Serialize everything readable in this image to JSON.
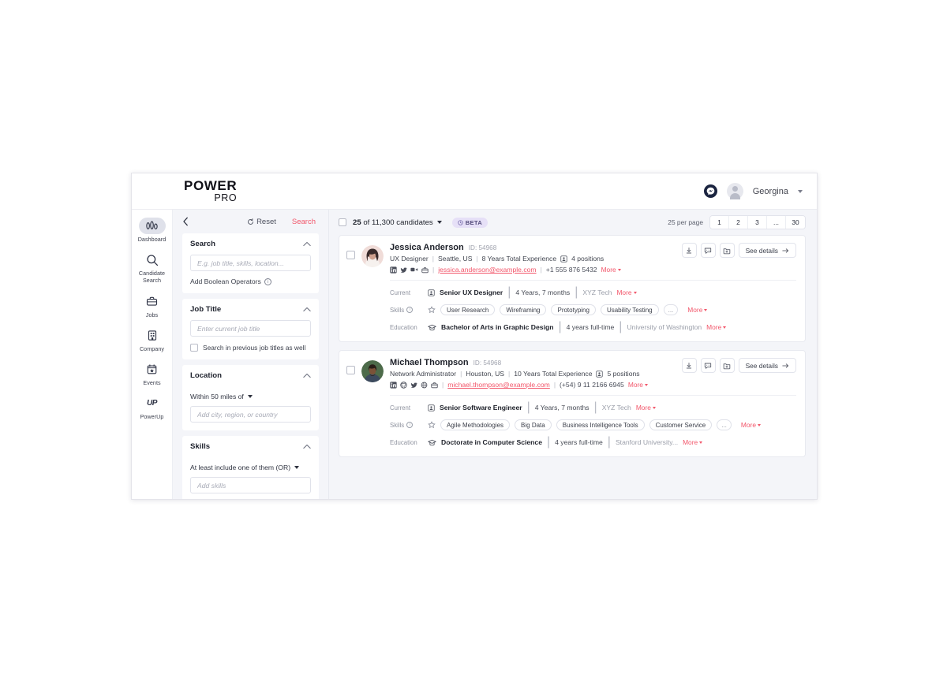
{
  "topbar": {
    "logo_line1": "POWER",
    "logo_line2": "PRO",
    "messenger_icon": "messenger-icon",
    "user_name": "Georgina"
  },
  "rail": {
    "items": [
      {
        "label": "Dashboard",
        "icon": "bar-chart-icon",
        "active": true
      },
      {
        "label": "Candidate Search",
        "icon": "magnifier-icon",
        "active": false
      },
      {
        "label": "Jobs",
        "icon": "briefcase-icon",
        "active": false
      },
      {
        "label": "Company",
        "icon": "building-icon",
        "active": false
      },
      {
        "label": "Events",
        "icon": "calendar-star-icon",
        "active": false
      },
      {
        "label": "PowerUp",
        "icon": "powerup-icon",
        "active": false
      }
    ]
  },
  "filters": {
    "back_icon": "chevron-left-icon",
    "reset_label": "Reset",
    "reset_icon": "refresh-icon",
    "search_label": "Search",
    "search_group": {
      "title": "Search",
      "input_placeholder": "E.g. job title, skills, location...",
      "boolean_label": "Add Boolean Operators",
      "boolean_info_icon": "info-icon"
    },
    "job_title_group": {
      "title": "Job Title",
      "input_placeholder": "Enter current job title",
      "checkbox_label": "Search in previous job titles as well"
    },
    "location_group": {
      "title": "Location",
      "radius_label": "Within 50 miles of",
      "input_placeholder": "Add city, region, or country"
    },
    "skills_group": {
      "title": "Skills",
      "operator_label": "At least include one of them (OR)",
      "input_placeholder": "Add skills"
    }
  },
  "results": {
    "toolbar": {
      "count_bold": "25",
      "count_rest": " of 11,300 candidates",
      "beta_label": "BETA",
      "beta_icon": "clock-icon",
      "per_page_label": "25 per page",
      "pages": [
        "1",
        "2",
        "3",
        "...",
        "30"
      ]
    },
    "actions": {
      "download_icon": "download-icon",
      "comment_icon": "comment-icon",
      "folder_add_icon": "folder-add-icon",
      "see_details_label": "See details",
      "see_details_icon": "arrow-right-icon"
    },
    "labels": {
      "current": "Current",
      "skills": "Skills",
      "education": "Education",
      "more": "More"
    },
    "candidates": [
      {
        "name": "Jessica Anderson",
        "id_label": "ID: 54968",
        "title": "UX Designer",
        "location": "Seattle, US",
        "experience": "8 Years Total Experience",
        "positions": "4 positions",
        "socials": [
          "linkedin-icon",
          "twitter-icon",
          "dribbble-icon",
          "briefcase-icon"
        ],
        "email": "jessica.anderson@example.com",
        "phone": "+1 555 876 5432",
        "current": {
          "role": "Senior UX Designer",
          "duration": "4 Years,  7 months",
          "company": "XYZ Tech"
        },
        "skills": [
          "User Research",
          "Wireframing",
          "Prototyping",
          "Usability Testing"
        ],
        "skills_overflow": "...",
        "education": {
          "degree": "Bachelor of Arts in Graphic Design",
          "duration": "4 years full-time",
          "school": "University of Washington"
        }
      },
      {
        "name": "Michael Thompson",
        "id_label": "ID: 54968",
        "title": "Network Administrator",
        "location": "Houston, US",
        "experience": "10 Years Total Experience",
        "positions": "5 positions",
        "socials": [
          "linkedin-icon",
          "github-icon",
          "twitter-icon",
          "globe-icon",
          "briefcase-icon"
        ],
        "email": "michael.thompson@example.com",
        "phone": "(+54) 9 11 2166 6945",
        "current": {
          "role": "Senior Software Engineer",
          "duration": "4 Years,  7 months",
          "company": "XYZ Tech"
        },
        "skills": [
          "Agile Methodologies",
          "Big Data",
          "Business Intelligence Tools",
          "Customer Service"
        ],
        "skills_overflow": "...",
        "education": {
          "degree": "Doctorate in Computer Science",
          "duration": "4 years full-time",
          "school": "Stanford University..."
        }
      }
    ]
  },
  "colors": {
    "accent_red": "#f2566a",
    "beta_bg": "#e6e0f7",
    "beta_text": "#524a7a",
    "panel_bg": "#f4f5f9",
    "ink": "#1d2029"
  }
}
